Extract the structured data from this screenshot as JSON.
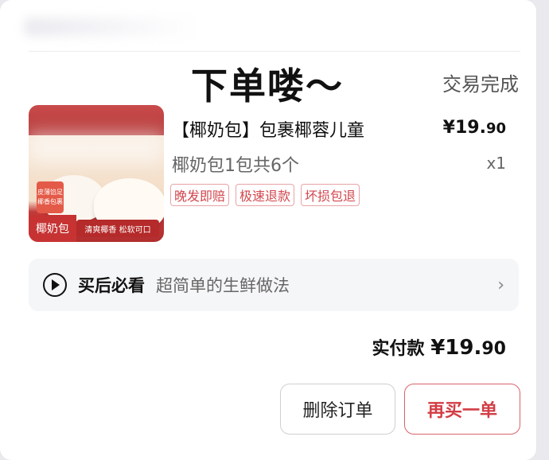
{
  "order": {
    "headline": "下单喽～",
    "status": "交易完成"
  },
  "item": {
    "title": "【椰奶包】包裹椰蓉儿童",
    "price_main": "¥19.",
    "price_cents": "90",
    "spec": "椰奶包1包共6个",
    "quantity": "x1",
    "badges": [
      "晚发即赔",
      "极速退款",
      "坏损包退"
    ],
    "image": {
      "side_tag_line1": "皮薄馅足",
      "side_tag_line2": "椰香包裹",
      "name": "椰奶包",
      "slogan": "清爽椰香 松软可口"
    }
  },
  "guide": {
    "label": "买后必看",
    "text": "超简单的生鲜做法",
    "icons": {
      "play": "play-circle-icon",
      "chevron": "chevron-right-icon"
    },
    "chevron": "›"
  },
  "payment": {
    "label": "实付款",
    "amount_main": "¥19.",
    "amount_cents": "90"
  },
  "actions": {
    "delete_label": "删除订单",
    "rebuy_label": "再买一单"
  },
  "colors": {
    "accent_red": "#d23d45",
    "badge_red": "#d2464d",
    "card_bg": "#ffffff",
    "page_bg": "#e9e9ee"
  }
}
